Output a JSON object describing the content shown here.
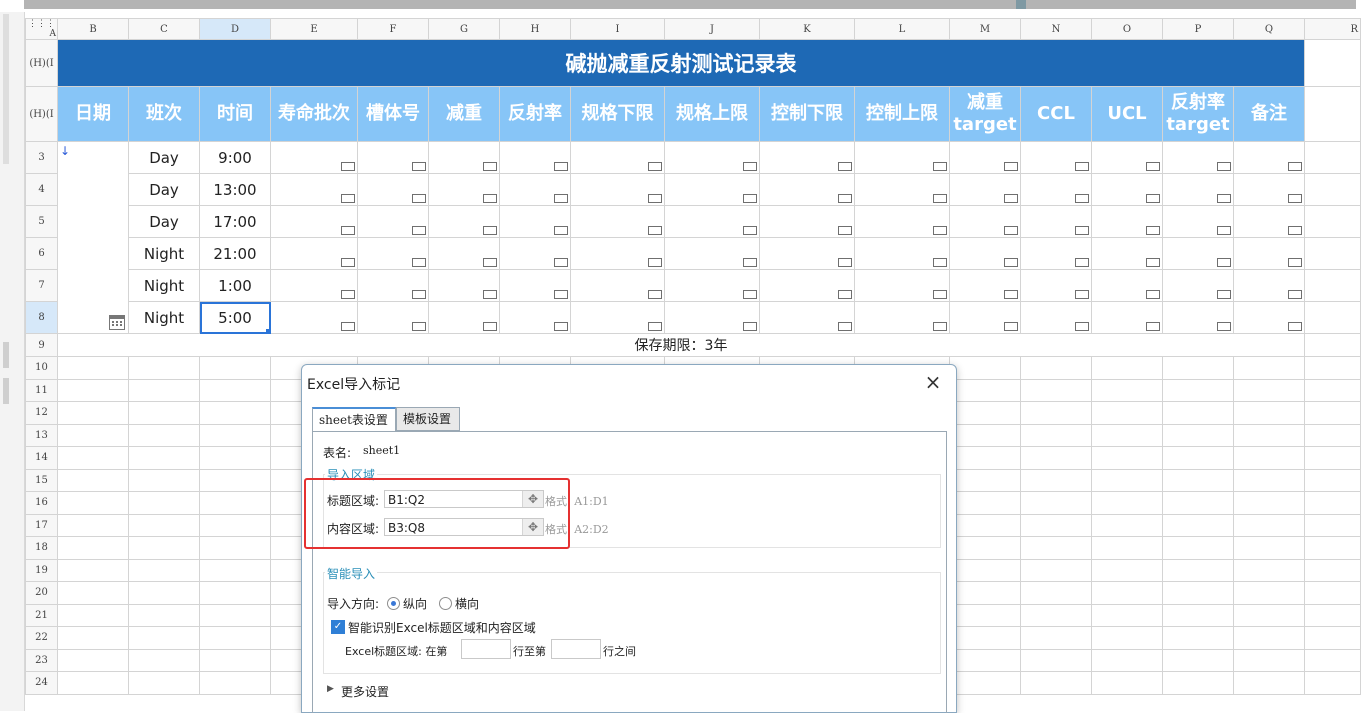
{
  "columns": [
    "A",
    "B",
    "C",
    "D",
    "E",
    "F",
    "G",
    "H",
    "I",
    "J",
    "K",
    "L",
    "M",
    "N",
    "O",
    "P",
    "Q",
    "R"
  ],
  "row_headers": [
    "(H)(I",
    "(H)(I",
    "3",
    "4",
    "5",
    "6",
    "7",
    "8",
    "9",
    "10",
    "11",
    "12",
    "13",
    "14",
    "15",
    "16",
    "17",
    "18",
    "19",
    "20",
    "21",
    "22",
    "23",
    "24"
  ],
  "sheet": {
    "title": "碱抛减重反射测试记录表",
    "headers": [
      "日期",
      "班次",
      "时间",
      "寿命批次",
      "槽体号",
      "减重",
      "反射率",
      "规格下限",
      "规格上限",
      "控制下限",
      "控制上限",
      "减重\ntarget",
      "CCL",
      "UCL",
      "反射率\ntarget",
      "备注"
    ],
    "rows": [
      {
        "shift": "Day",
        "time": "9:00"
      },
      {
        "shift": "Day",
        "time": "13:00"
      },
      {
        "shift": "Day",
        "time": "17:00"
      },
      {
        "shift": "Night",
        "time": "21:00"
      },
      {
        "shift": "Night",
        "time": "1:00"
      },
      {
        "shift": "Night",
        "time": "5:00"
      }
    ],
    "retention_note": "保存期限：3年"
  },
  "dialog": {
    "title": "Excel导入标记",
    "close_icon": "×",
    "tabs": [
      "sheet表设置",
      "模板设置"
    ],
    "sheet_name_label": "表名:",
    "sheet_name_value": "sheet1",
    "import_area_title": "导入区域",
    "title_area_label": "标题区域:",
    "title_area_value": "B1:Q2",
    "title_area_hint": "格式: A1:D1",
    "content_area_label": "内容区域:",
    "content_area_value": "B3:Q8",
    "content_area_hint": "格式: A2:D2",
    "smart_import_title": "智能导入",
    "direction_label": "导入方向:",
    "direction_options": [
      "纵向",
      "横向"
    ],
    "direction_selected": "纵向",
    "smart_detect_label": "智能识别Excel标题区域和内容区域",
    "smart_detect_checked": true,
    "title_row_label_prefix": "Excel标题区域: 在第",
    "title_row_label_mid": "行至第",
    "title_row_label_suffix": "行之间",
    "title_row_from": "",
    "title_row_to": "",
    "more_settings_label": "更多设置"
  },
  "colors": {
    "title_bg": "#1e69b5",
    "header_bg": "#87c5f7",
    "highlight_box": "#e53131",
    "section_title": "#2a8fb8",
    "selection": "#2a74d8"
  }
}
